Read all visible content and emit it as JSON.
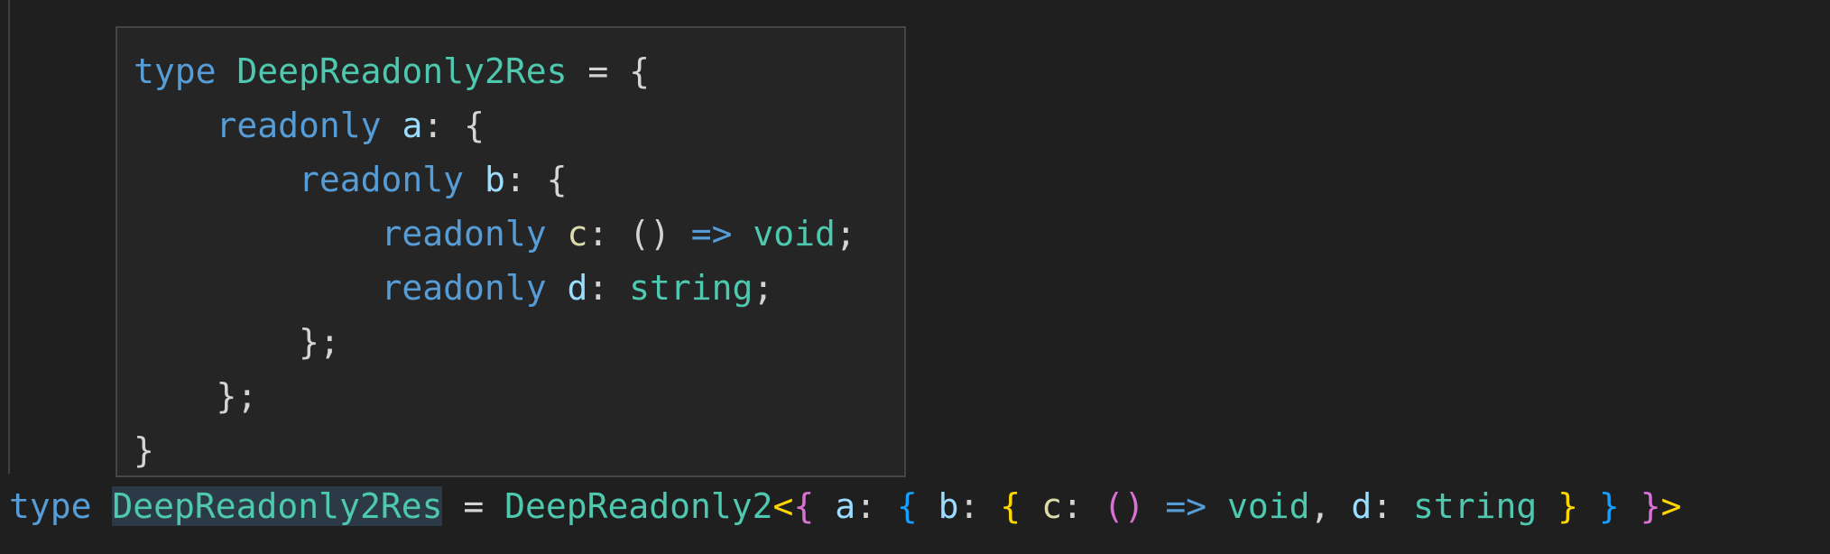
{
  "hover": {
    "lines": [
      {
        "indent": "",
        "tokens": [
          {
            "t": "type",
            "c": "kw"
          },
          {
            "t": " ",
            "c": "punc"
          },
          {
            "t": "DeepReadonly2Res",
            "c": "type"
          },
          {
            "t": " = {",
            "c": "punc"
          }
        ]
      },
      {
        "indent": "    ",
        "tokens": [
          {
            "t": "readonly",
            "c": "kw"
          },
          {
            "t": " ",
            "c": "punc"
          },
          {
            "t": "a",
            "c": "prop"
          },
          {
            "t": ": {",
            "c": "punc"
          }
        ]
      },
      {
        "indent": "        ",
        "tokens": [
          {
            "t": "readonly",
            "c": "kw"
          },
          {
            "t": " ",
            "c": "punc"
          },
          {
            "t": "b",
            "c": "prop"
          },
          {
            "t": ": {",
            "c": "punc"
          }
        ]
      },
      {
        "indent": "            ",
        "tokens": [
          {
            "t": "readonly",
            "c": "kw"
          },
          {
            "t": " ",
            "c": "punc"
          },
          {
            "t": "c",
            "c": "fn"
          },
          {
            "t": ": () ",
            "c": "punc"
          },
          {
            "t": "=>",
            "c": "kw"
          },
          {
            "t": " ",
            "c": "punc"
          },
          {
            "t": "void",
            "c": "type"
          },
          {
            "t": ";",
            "c": "punc"
          }
        ]
      },
      {
        "indent": "            ",
        "tokens": [
          {
            "t": "readonly",
            "c": "kw"
          },
          {
            "t": " ",
            "c": "punc"
          },
          {
            "t": "d",
            "c": "prop"
          },
          {
            "t": ": ",
            "c": "punc"
          },
          {
            "t": "string",
            "c": "type"
          },
          {
            "t": ";",
            "c": "punc"
          }
        ]
      },
      {
        "indent": "        ",
        "tokens": [
          {
            "t": "};",
            "c": "punc"
          }
        ]
      },
      {
        "indent": "    ",
        "tokens": [
          {
            "t": "};",
            "c": "punc"
          }
        ]
      },
      {
        "indent": "",
        "tokens": [
          {
            "t": "}",
            "c": "punc"
          }
        ]
      }
    ]
  },
  "code": {
    "tokens": [
      {
        "t": "type",
        "c": "kw"
      },
      {
        "t": " ",
        "c": "punc"
      },
      {
        "t": "DeepReadonly2Res",
        "c": "type",
        "highlight": true
      },
      {
        "t": " = ",
        "c": "punc"
      },
      {
        "t": "DeepReadonly2",
        "c": "type"
      },
      {
        "t": "<",
        "c": "b3"
      },
      {
        "t": "{",
        "c": "b1"
      },
      {
        "t": " ",
        "c": "punc"
      },
      {
        "t": "a",
        "c": "prop"
      },
      {
        "t": ": ",
        "c": "punc"
      },
      {
        "t": "{",
        "c": "b2"
      },
      {
        "t": " ",
        "c": "punc"
      },
      {
        "t": "b",
        "c": "prop"
      },
      {
        "t": ": ",
        "c": "punc"
      },
      {
        "t": "{",
        "c": "b3"
      },
      {
        "t": " ",
        "c": "punc"
      },
      {
        "t": "c",
        "c": "fn"
      },
      {
        "t": ": ",
        "c": "punc"
      },
      {
        "t": "()",
        "c": "b1"
      },
      {
        "t": " ",
        "c": "punc"
      },
      {
        "t": "=>",
        "c": "kw"
      },
      {
        "t": " ",
        "c": "punc"
      },
      {
        "t": "void",
        "c": "type"
      },
      {
        "t": ", ",
        "c": "punc"
      },
      {
        "t": "d",
        "c": "prop"
      },
      {
        "t": ": ",
        "c": "punc"
      },
      {
        "t": "string",
        "c": "type"
      },
      {
        "t": " ",
        "c": "punc"
      },
      {
        "t": "}",
        "c": "b3"
      },
      {
        "t": " ",
        "c": "punc"
      },
      {
        "t": "}",
        "c": "b2"
      },
      {
        "t": " ",
        "c": "punc"
      },
      {
        "t": "}",
        "c": "b1"
      },
      {
        "t": ">",
        "c": "b3"
      }
    ]
  },
  "colors": {
    "background": "#1f1f1f",
    "hover_background": "#252526",
    "hover_border": "#454545",
    "keyword": "#569cd6",
    "type": "#4ec9b0",
    "property": "#9cdcfe",
    "function": "#dcdcaa",
    "bracket_1": "#da70d6",
    "bracket_2": "#179fff",
    "bracket_3": "#ffd700"
  }
}
